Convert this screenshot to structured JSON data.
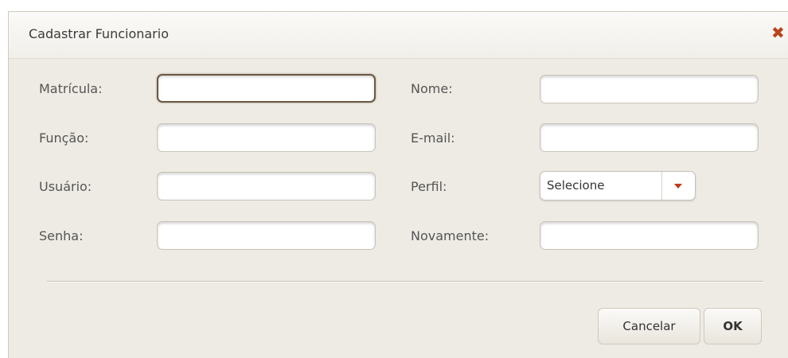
{
  "dialog": {
    "title": "Cadastrar Funcionario",
    "close_icon": "close-icon"
  },
  "form": {
    "matricula": {
      "label": "Matrícula:",
      "value": ""
    },
    "nome": {
      "label": "Nome:",
      "value": ""
    },
    "funcao": {
      "label": "Função:",
      "value": ""
    },
    "email": {
      "label": "E-mail:",
      "value": ""
    },
    "usuario": {
      "label": "Usuário:",
      "value": ""
    },
    "perfil": {
      "label": "Perfil:",
      "selected": "Selecione"
    },
    "senha": {
      "label": "Senha:",
      "value": ""
    },
    "novamente": {
      "label": "Novamente:",
      "value": ""
    }
  },
  "buttons": {
    "cancel": "Cancelar",
    "ok": "OK"
  },
  "colors": {
    "close_icon": "#b8441c",
    "dropdown_arrow": "#c03a17",
    "dialog_background": "#eeebe4"
  }
}
